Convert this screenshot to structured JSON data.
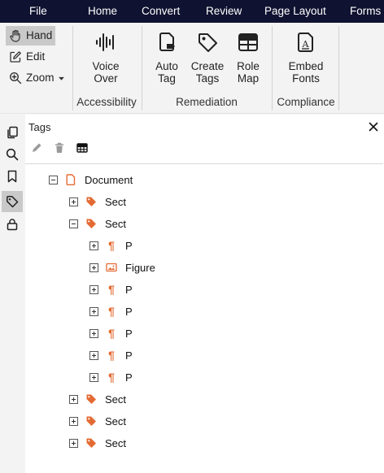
{
  "menu": [
    "File",
    "Home",
    "Convert",
    "Review",
    "Page Layout",
    "Forms"
  ],
  "ribbon": {
    "tools": [
      {
        "label": "Hand",
        "icon": "hand-icon",
        "active": true
      },
      {
        "label": "Edit",
        "icon": "edit-icon"
      },
      {
        "label": "Zoom",
        "icon": "zoom-icon",
        "dropdown": true
      }
    ],
    "groups": {
      "accessibility": {
        "label": "Accessibility",
        "buttons": [
          {
            "line1": "Voice",
            "line2": "Over",
            "icon": "voice-over-icon"
          }
        ]
      },
      "remediation": {
        "label": "Remediation",
        "buttons": [
          {
            "line1": "Auto",
            "line2": "Tag",
            "icon": "auto-tag-icon"
          },
          {
            "line1": "Create",
            "line2": "Tags",
            "icon": "create-tags-icon"
          },
          {
            "line1": "Role",
            "line2": "Map",
            "icon": "role-map-icon"
          }
        ]
      },
      "compliance": {
        "label": "Compliance",
        "buttons": [
          {
            "line1": "Embed",
            "line2": "Fonts",
            "icon": "embed-fonts-icon"
          }
        ]
      }
    }
  },
  "sidebar": {
    "icons": [
      "pages-icon",
      "search-icon",
      "bookmark-icon",
      "tag-icon",
      "lock-icon"
    ],
    "active": "tag-icon"
  },
  "panel": {
    "title": "Tags",
    "toolbar": [
      "edit-icon",
      "delete-icon",
      "table-icon"
    ]
  },
  "tree": [
    {
      "label": "Document",
      "type": "document",
      "expanded": true
    },
    {
      "label": "Sect",
      "type": "tag",
      "expanded": false
    },
    {
      "label": "Sect",
      "type": "tag",
      "expanded": true
    },
    {
      "label": "P",
      "type": "paragraph",
      "expanded": false
    },
    {
      "label": "Figure",
      "type": "figure",
      "expanded": false
    },
    {
      "label": "P",
      "type": "paragraph",
      "expanded": false
    },
    {
      "label": "P",
      "type": "paragraph",
      "expanded": false
    },
    {
      "label": "P",
      "type": "paragraph",
      "expanded": false
    },
    {
      "label": "P",
      "type": "paragraph",
      "expanded": false
    },
    {
      "label": "P",
      "type": "paragraph",
      "expanded": false
    },
    {
      "label": "Sect",
      "type": "tag",
      "expanded": false
    },
    {
      "label": "Sect",
      "type": "tag",
      "expanded": false
    },
    {
      "label": "Sect",
      "type": "tag",
      "expanded": false
    }
  ],
  "colors": {
    "menubar": "#0f1230",
    "accent": "#e36b33",
    "active": "#c9c9c9"
  }
}
